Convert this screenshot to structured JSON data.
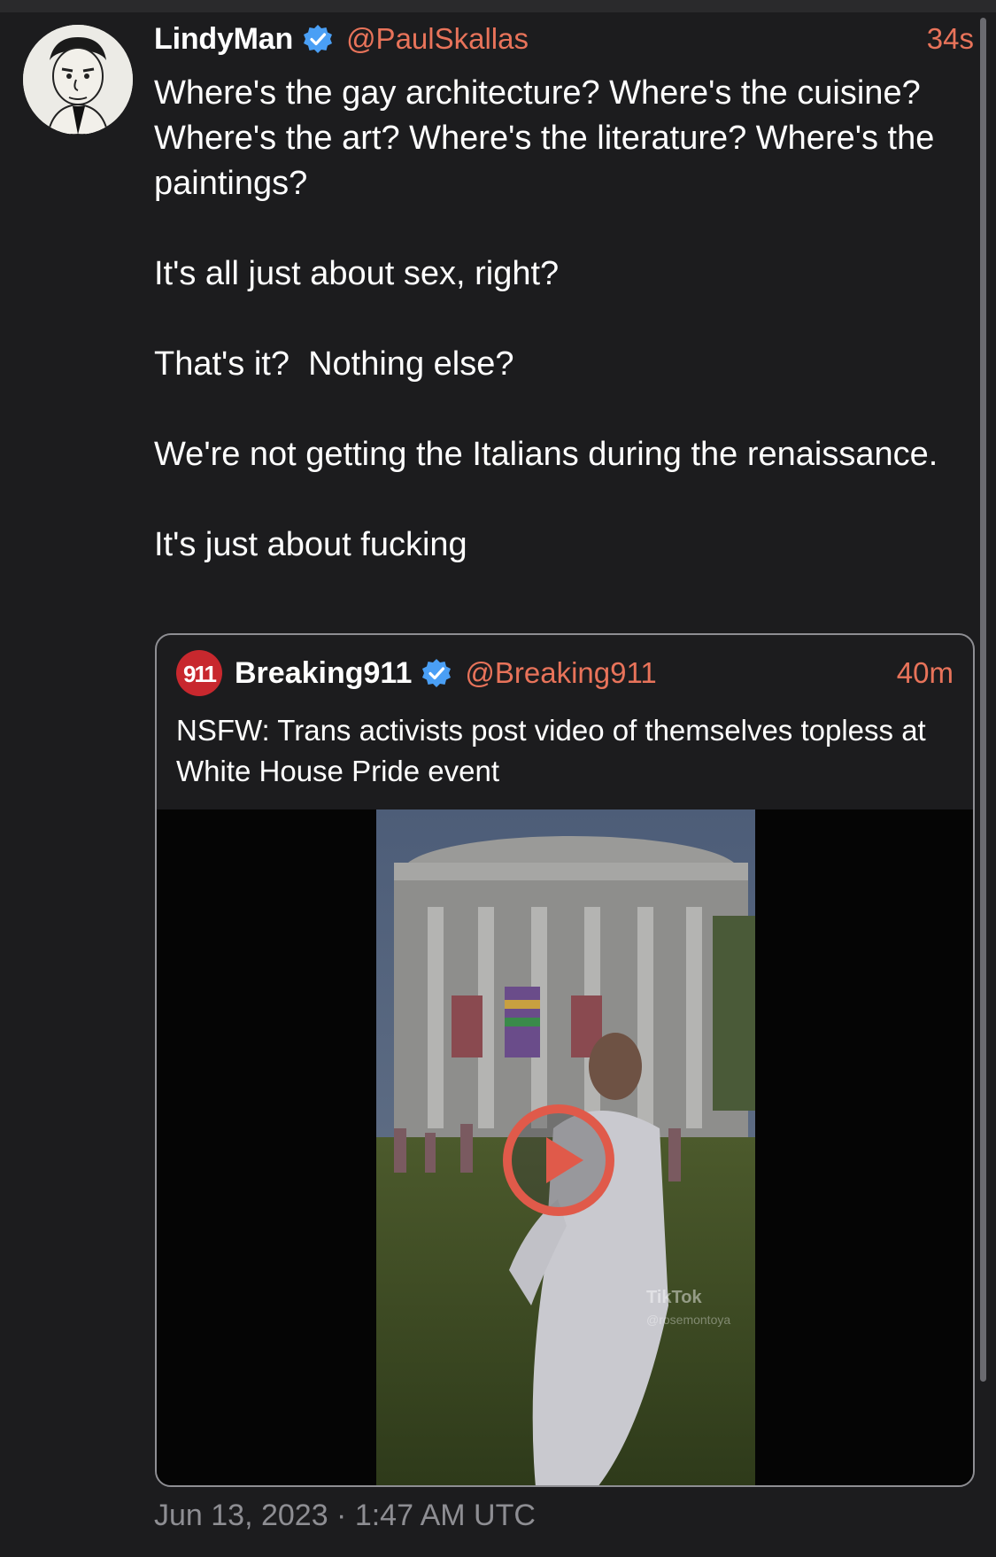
{
  "tweet": {
    "author_name": "LindyMan",
    "author_handle": "@PaulSkallas",
    "time_ago": "34s",
    "paragraphs": [
      "Where's the gay architecture? Where's the cuisine? Where's the art? Where's the literature? Where's the paintings?",
      "It's all just about sex, right?",
      "That's it?  Nothing else?",
      "We're not getting the Italians during the renaissance.",
      "It's just about fucking"
    ],
    "date": "Jun 13, 2023 · 1:47 AM UTC"
  },
  "quote": {
    "avatar_text": "911",
    "author_name": "Breaking911",
    "author_handle": "@Breaking911",
    "time_ago": "40m",
    "text": "NSFW: Trans activists post video of themselves topless at White House Pride event",
    "video_watermark": "TikTok",
    "video_watermark_user": "@rosemontoya"
  },
  "icons": {
    "verified": "verified-badge-icon",
    "play": "play-icon"
  },
  "colors": {
    "background": "#1c1c1e",
    "accent": "#e8735a",
    "verified": "#1d9bf0",
    "muted": "#8e8e93"
  }
}
